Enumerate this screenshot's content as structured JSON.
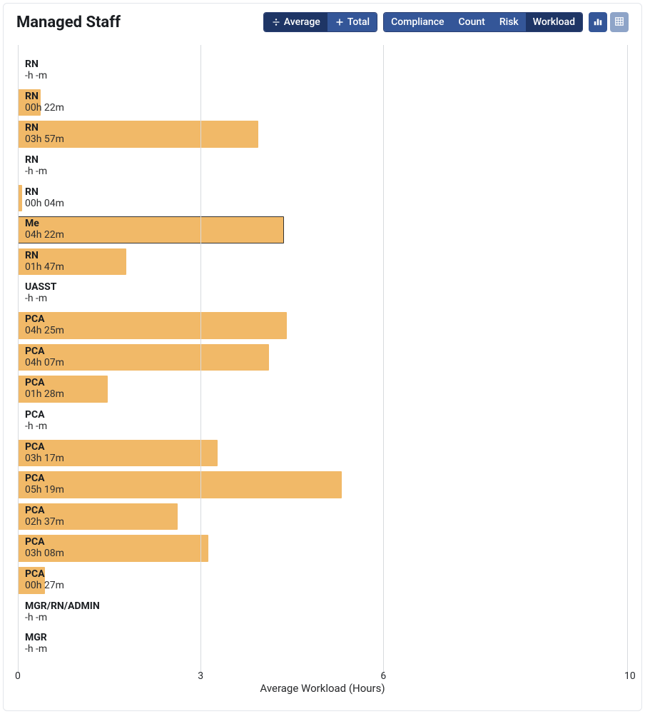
{
  "header": {
    "title": "Managed Staff",
    "seg1": [
      {
        "icon": "divide",
        "label": "Average",
        "selected": true
      },
      {
        "icon": "plus",
        "label": "Total",
        "selected": false
      }
    ],
    "seg2": [
      {
        "label": "Compliance",
        "selected": false
      },
      {
        "label": "Count",
        "selected": false
      },
      {
        "label": "Risk",
        "selected": false
      },
      {
        "label": "Workload",
        "selected": true
      }
    ],
    "viewtoggle": [
      {
        "name": "chart-view",
        "active": true
      },
      {
        "name": "table-view",
        "active": false
      }
    ]
  },
  "chart_data": {
    "type": "bar",
    "orientation": "horizontal",
    "title": "Managed Staff",
    "xlabel": "Average Workload (Hours)",
    "xlim": [
      0,
      10
    ],
    "xticks": [
      0,
      3,
      6,
      10
    ],
    "categories": [
      "RN",
      "RN",
      "RN",
      "RN",
      "RN",
      "Me",
      "RN",
      "UASST",
      "PCA",
      "PCA",
      "PCA",
      "PCA",
      "PCA",
      "PCA",
      "PCA",
      "PCA",
      "PCA",
      "MGR/RN/ADMIN",
      "MGR"
    ],
    "value_labels": [
      "-h -m",
      "00h 22m",
      "03h 57m",
      "-h -m",
      "00h 04m",
      "04h 22m",
      "01h 47m",
      "-h -m",
      "04h 25m",
      "04h 07m",
      "01h 28m",
      "-h -m",
      "03h 17m",
      "05h 19m",
      "02h 37m",
      "03h 08m",
      "00h 27m",
      "-h -m",
      "-h -m"
    ],
    "values": [
      0,
      0.37,
      3.95,
      0,
      0.07,
      4.37,
      1.78,
      0,
      4.42,
      4.12,
      1.47,
      0,
      3.28,
      5.32,
      2.62,
      3.13,
      0.45,
      0,
      0
    ],
    "highlight_index": 5,
    "bar_color": "#f1b968"
  }
}
